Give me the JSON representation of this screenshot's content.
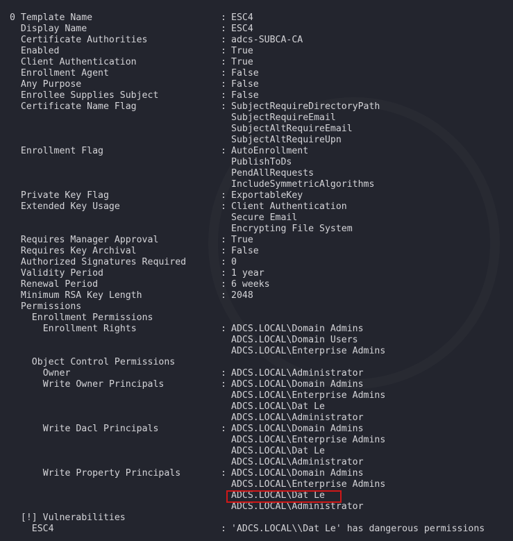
{
  "index_label": "0",
  "separator": ":",
  "lines": [
    {
      "label": "Template Name",
      "indent": 2,
      "value": "ESC4"
    },
    {
      "label": "Display Name",
      "indent": 2,
      "value": "ESC4"
    },
    {
      "label": "Certificate Authorities",
      "indent": 2,
      "value": "adcs-SUBCA-CA"
    },
    {
      "label": "Enabled",
      "indent": 2,
      "value": "True"
    },
    {
      "label": "Client Authentication",
      "indent": 2,
      "value": "True"
    },
    {
      "label": "Enrollment Agent",
      "indent": 2,
      "value": "False"
    },
    {
      "label": "Any Purpose",
      "indent": 2,
      "value": "False"
    },
    {
      "label": "Enrollee Supplies Subject",
      "indent": 2,
      "value": "False"
    },
    {
      "label": "Certificate Name Flag",
      "indent": 2,
      "value": "SubjectRequireDirectoryPath"
    },
    {
      "value": "SubjectRequireEmail"
    },
    {
      "value": "SubjectAltRequireEmail"
    },
    {
      "value": "SubjectAltRequireUpn"
    },
    {
      "label": "Enrollment Flag",
      "indent": 2,
      "value": "AutoEnrollment"
    },
    {
      "value": "PublishToDs"
    },
    {
      "value": "PendAllRequests"
    },
    {
      "value": "IncludeSymmetricAlgorithms"
    },
    {
      "label": "Private Key Flag",
      "indent": 2,
      "value": "ExportableKey"
    },
    {
      "label": "Extended Key Usage",
      "indent": 2,
      "value": "Client Authentication"
    },
    {
      "value": "Secure Email"
    },
    {
      "value": "Encrypting File System"
    },
    {
      "label": "Requires Manager Approval",
      "indent": 2,
      "value": "True"
    },
    {
      "label": "Requires Key Archival",
      "indent": 2,
      "value": "False"
    },
    {
      "label": "Authorized Signatures Required",
      "indent": 2,
      "value": "0"
    },
    {
      "label": "Validity Period",
      "indent": 2,
      "value": "1 year"
    },
    {
      "label": "Renewal Period",
      "indent": 2,
      "value": "6 weeks"
    },
    {
      "label": "Minimum RSA Key Length",
      "indent": 2,
      "value": "2048"
    },
    {
      "label": "Permissions",
      "indent": 2
    },
    {
      "label": "Enrollment Permissions",
      "indent": 4
    },
    {
      "label": "Enrollment Rights",
      "indent": 6,
      "value": "ADCS.LOCAL\\Domain Admins"
    },
    {
      "value": "ADCS.LOCAL\\Domain Users"
    },
    {
      "value": "ADCS.LOCAL\\Enterprise Admins"
    },
    {
      "label": "Object Control Permissions",
      "indent": 4
    },
    {
      "label": "Owner",
      "indent": 6,
      "value": "ADCS.LOCAL\\Administrator"
    },
    {
      "label": "Write Owner Principals",
      "indent": 6,
      "value": "ADCS.LOCAL\\Domain Admins"
    },
    {
      "value": "ADCS.LOCAL\\Enterprise Admins"
    },
    {
      "value": "ADCS.LOCAL\\Dat Le"
    },
    {
      "value": "ADCS.LOCAL\\Administrator"
    },
    {
      "label": "Write Dacl Principals",
      "indent": 6,
      "value": "ADCS.LOCAL\\Domain Admins"
    },
    {
      "value": "ADCS.LOCAL\\Enterprise Admins"
    },
    {
      "value": "ADCS.LOCAL\\Dat Le"
    },
    {
      "value": "ADCS.LOCAL\\Administrator"
    },
    {
      "label": "Write Property Principals",
      "indent": 6,
      "value": "ADCS.LOCAL\\Domain Admins"
    },
    {
      "value": "ADCS.LOCAL\\Enterprise Admins"
    },
    {
      "value": "ADCS.LOCAL\\Dat Le",
      "highlight": true
    },
    {
      "value": "ADCS.LOCAL\\Administrator"
    },
    {
      "label": "[!] Vulnerabilities",
      "indent": 2
    },
    {
      "label": "ESC4",
      "indent": 4,
      "value": "'ADCS.LOCAL\\\\Dat Le' has dangerous permissions"
    }
  ],
  "colors": {
    "background": "#23252e",
    "text": "#d4d4d8",
    "highlight_border": "#d01818"
  }
}
